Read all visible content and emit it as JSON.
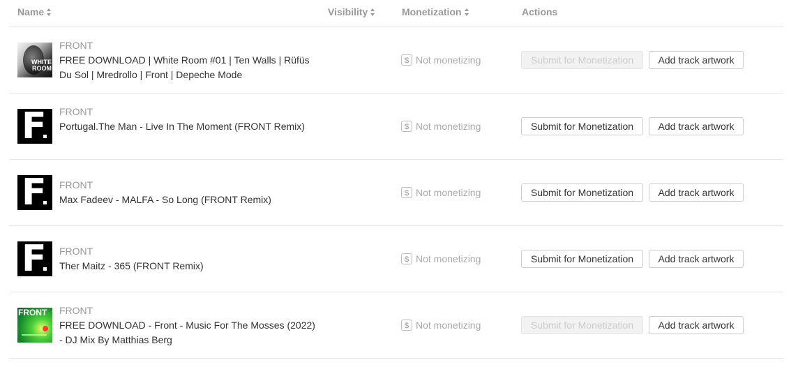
{
  "header": {
    "name": "Name",
    "visibility": "Visibility",
    "monetization": "Monetization",
    "actions": "Actions"
  },
  "tracks": [
    {
      "artist": "FRONT",
      "title": "FREE DOWNLOAD | White Room #01 | Ten Walls | Rüfüs Du Sol | Mredrollo | Front | Depeche Mode",
      "artwork_text": "WHITE ROOM",
      "monetization": "Not monetizing",
      "submit": "Submit for Monetization",
      "submit_disabled": true,
      "add_artwork": "Add track artwork"
    },
    {
      "artist": "FRONT",
      "title": "Portugal.The Man - Live In The Moment (FRONT Remix)",
      "artwork_text": "F",
      "monetization": "Not monetizing",
      "submit": "Submit for Monetization",
      "submit_disabled": false,
      "add_artwork": "Add track artwork"
    },
    {
      "artist": "FRONT",
      "title": "Max Fadeev - MALFA - So Long (FRONT Remix)",
      "artwork_text": "F",
      "monetization": "Not monetizing",
      "submit": "Submit for Monetization",
      "submit_disabled": false,
      "add_artwork": "Add track artwork"
    },
    {
      "artist": "FRONT",
      "title": "Ther Maitz - 365 (FRONT Remix)",
      "artwork_text": "F",
      "monetization": "Not monetizing",
      "submit": "Submit for Monetization",
      "submit_disabled": false,
      "add_artwork": "Add track artwork"
    },
    {
      "artist": "FRONT",
      "title": "FREE DOWNLOAD - Front - Music For The Mosses (2022) - DJ Mix By Matthias Berg",
      "artwork_text": "FRONT",
      "monetization": "Not monetizing",
      "submit": "Submit for Monetization",
      "submit_disabled": true,
      "add_artwork": "Add track artwork"
    }
  ],
  "icons": {
    "dollar": "$"
  },
  "colors": {
    "header_text": "#999999",
    "divider": "#e5e5e5",
    "disabled_button_bg": "#f2f2f2"
  }
}
